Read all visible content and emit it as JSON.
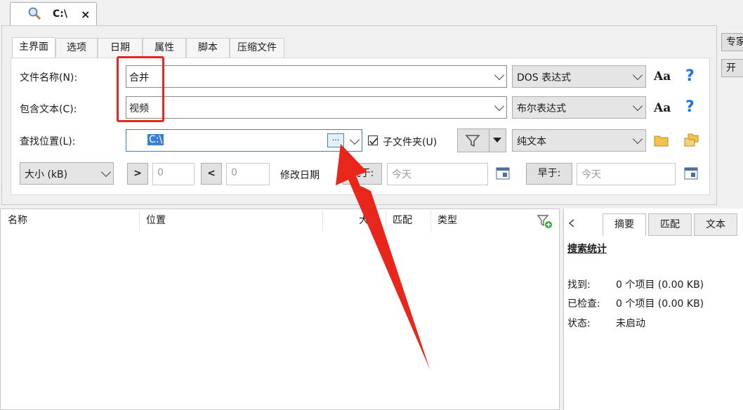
{
  "doc_tab": {
    "title": "C:\\",
    "close": "×"
  },
  "tabs": [
    "主界面",
    "选项",
    "日期",
    "属性",
    "脚本",
    "压缩文件"
  ],
  "filename": {
    "label": "文件名称(N):",
    "value": "合并",
    "mode": "DOS 表达式",
    "case": "Aa",
    "help": "?"
  },
  "contains": {
    "label": "包含文本(C):",
    "value": "视频",
    "mode": "布尔表达式",
    "case": "Aa",
    "help": "?"
  },
  "location": {
    "label": "查找位置(L):",
    "value": "C:\\",
    "browse": "···",
    "subfolder": "子文件夹(U)",
    "text_mode": "纯文本"
  },
  "size": {
    "unit": "大小 (kB)",
    "gt": ">",
    "gt_value": "0",
    "lt": "<",
    "lt_value": "0"
  },
  "date": {
    "label": "修改日期",
    "after_btn": "晚于:",
    "after_value": "今天",
    "before_btn": "早于:",
    "before_value": "今天"
  },
  "side": {
    "expert": "专家",
    "open": "开"
  },
  "results": {
    "columns": [
      "名称",
      "位置",
      "大小",
      "匹配",
      "类型"
    ]
  },
  "right_panel": {
    "tabs": [
      "摘要",
      "匹配",
      "文本"
    ],
    "title": "搜索统计",
    "stats": [
      {
        "key": "找到:",
        "value": "0 个项目 (0.00 KB)"
      },
      {
        "key": "已检查:",
        "value": "0 个项目 (0.00 KB)"
      },
      {
        "key": "状态:",
        "value": "未启动"
      }
    ]
  },
  "colors": {
    "accent": "#1a73e8",
    "highlight": "#e8261b",
    "selection": "#3a7fd6"
  }
}
